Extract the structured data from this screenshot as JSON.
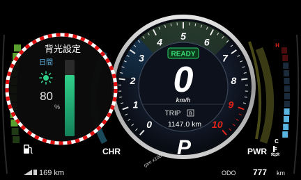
{
  "cluster": {
    "status_badge": "READY",
    "speed": {
      "value": "0",
      "unit": "km/h"
    },
    "tachometer": {
      "labels": [
        "0",
        "1",
        "2",
        "3",
        "4",
        "5",
        "6",
        "7",
        "8",
        "9",
        "10"
      ],
      "multiplier_label": "rpm x1000",
      "redline_from": 9
    },
    "trip": {
      "label": "TRIP",
      "mode": "B",
      "value": "1147.0 km"
    },
    "gear": "P",
    "hybrid_gauge": {
      "left_label": "CHR",
      "right_label": "PWR"
    },
    "fuel": {
      "range": "169 km"
    },
    "odometer": {
      "label": "ODO",
      "value": "777",
      "unit": "km"
    },
    "coolant": {
      "high_label": "H",
      "low_label": "C"
    },
    "fuel_gauge_label": "F"
  },
  "backlight_popup": {
    "title": "背光設定",
    "mode_label": "日間",
    "value": "80",
    "unit": "%",
    "level_fraction": 0.8
  },
  "colors": {
    "accent_green": "#1fa36a",
    "ready_green": "#2bd46b",
    "redline": "#e2231a",
    "popup_dash": "#e01010",
    "fuel_green": "#5aa02e",
    "coolant_blue": "#5ab4e0"
  },
  "icons": [
    "sun-icon",
    "fuel-pump-icon",
    "engine-temp-icon",
    "range-icon"
  ]
}
